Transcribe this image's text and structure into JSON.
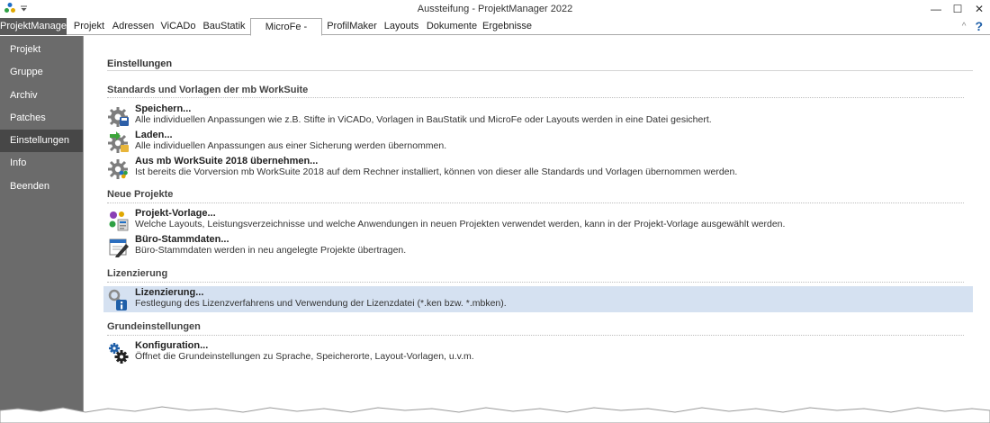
{
  "window": {
    "title": "Aussteifung - ProjektManager 2022",
    "controls": {
      "minimize": "—",
      "maximize": "☐",
      "close": "✕"
    }
  },
  "qat": {
    "icons": [
      "app-logo-icon",
      "dropdown-arrow-icon"
    ]
  },
  "ribbon": {
    "app_tab": "ProjektManager",
    "tabs": [
      "Projekt",
      "Adressen",
      "ViCADo",
      "BauStatik",
      "MicroFe - EuroSta",
      "ProfilMaker",
      "Layouts",
      "Dokumente",
      "Ergebnisse"
    ],
    "active_tab": "MicroFe - EuroSta",
    "collapse": "^",
    "help": "?"
  },
  "sidebar": {
    "items": [
      "Projekt",
      "Gruppe",
      "Archiv",
      "Patches",
      "Einstellungen",
      "Info",
      "Beenden"
    ],
    "active": "Einstellungen"
  },
  "main": {
    "title": "Einstellungen",
    "sections": [
      {
        "heading": "Standards und Vorlagen der mb WorkSuite",
        "entries": [
          {
            "title": "Speichern...",
            "desc": "Alle individuellen Anpassungen wie z.B. Stifte in ViCADo, Vorlagen in BauStatik und MicroFe oder Layouts werden in eine Datei gesichert.",
            "icon": "save-gear-icon"
          },
          {
            "title": "Laden...",
            "desc": "Alle individuellen Anpassungen aus einer Sicherung werden übernommen.",
            "icon": "load-gear-icon"
          },
          {
            "title": "Aus mb WorkSuite 2018 übernehmen...",
            "desc": "Ist bereits die Vorversion mb WorkSuite 2018 auf dem Rechner installiert, können von dieser alle Standards und Vorlagen übernommen werden.",
            "icon": "import-gear-icon"
          }
        ]
      },
      {
        "heading": "Neue Projekte",
        "entries": [
          {
            "title": "Projekt-Vorlage...",
            "desc": "Welche Layouts, Leistungsverzeichnisse und welche Anwendungen in neuen Projekten verwendet werden, kann in der Projekt-Vorlage ausgewählt werden.",
            "icon": "project-template-icon"
          },
          {
            "title": "Büro-Stammdaten...",
            "desc": "Büro-Stammdaten werden in neu angelegte Projekte übertragen.",
            "icon": "office-data-icon"
          }
        ]
      },
      {
        "heading": "Lizenzierung",
        "entries": [
          {
            "title": "Lizenzierung...",
            "desc": "Festlegung des Lizenzverfahrens und Verwendung der Lizenzdatei (*.ken bzw. *.mbken).",
            "icon": "license-key-icon",
            "selected": true
          }
        ]
      },
      {
        "heading": "Grundeinstellungen",
        "entries": [
          {
            "title": "Konfiguration...",
            "desc": "Öffnet die Grundeinstellungen zu Sprache, Speicherorte, Layout-Vorlagen, u.v.m.",
            "icon": "configuration-gears-icon"
          }
        ]
      }
    ]
  },
  "colors": {
    "sidebar_bg": "#6b6b6b",
    "sidebar_active": "#474747",
    "selection": "#d5e1f1",
    "help_accent": "#1f5fa8"
  }
}
